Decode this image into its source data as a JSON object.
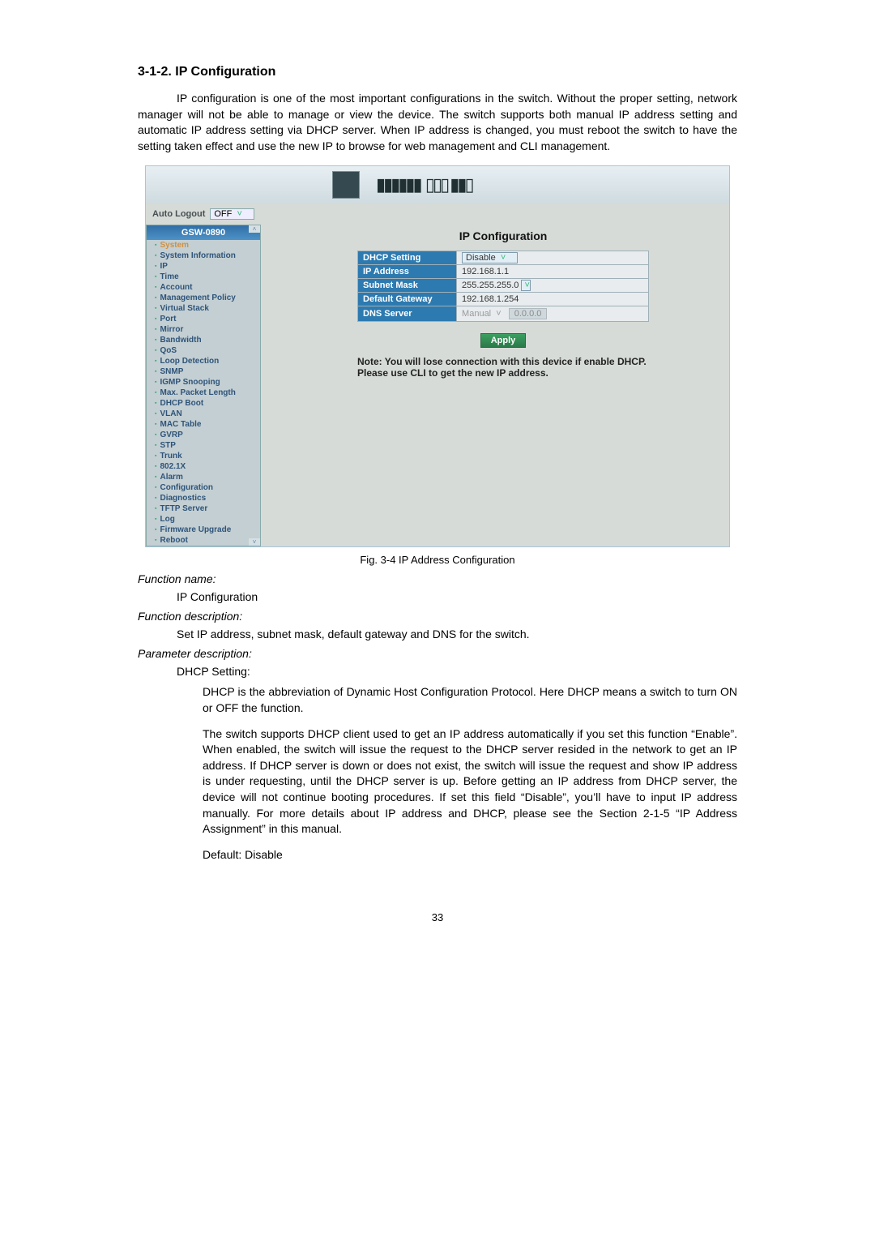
{
  "doc": {
    "heading": "3-1-2. IP Configuration",
    "intro": "IP configuration is one of the most important configurations in the switch. Without the proper setting, network manager will not be able to manage or view the device. The switch supports both manual IP address setting and automatic IP address setting via DHCP server. When IP address is changed, you must reboot the switch to have the setting taken effect and use the new IP to browse for web management and CLI management.",
    "fig_caption": "Fig. 3-4 IP Address Configuration",
    "fn_name_label": "Function name:",
    "fn_name_value": "IP Configuration",
    "fn_desc_label": "Function description:",
    "fn_desc_value": "Set IP address, subnet mask, default gateway and DNS for the switch.",
    "param_label": "Parameter description:",
    "param_name": "DHCP Setting:",
    "param_body1": "DHCP is the abbreviation of Dynamic Host Configuration Protocol. Here DHCP means a switch to turn ON or OFF the function.",
    "param_body2": "The switch supports DHCP client used to get an IP address automatically if you set this function “Enable”. When enabled, the switch will issue the request to the DHCP server resided in the network to get an IP address. If DHCP server is down or does not exist, the switch will issue the request and show IP address is under requesting, until the DHCP server is up. Before getting an IP address from DHCP server, the device will not continue booting procedures. If set this field “Disable”, you’ll have to input IP address manually. For more details about IP address and DHCP, please see the Section 2-1-5 “IP Address Assignment” in this manual.",
    "param_default": "Default:  Disable",
    "page_number": "33"
  },
  "ui": {
    "auto_logout_label": "Auto Logout",
    "auto_logout_value": "OFF",
    "device_model": "GSW-0890",
    "sidebar": {
      "items": [
        "System",
        "System Information",
        "IP",
        "Time",
        "Account",
        "Management Policy",
        "Virtual Stack",
        "Port",
        "Mirror",
        "Bandwidth",
        "QoS",
        "Loop Detection",
        "SNMP",
        "IGMP Snooping",
        "Max. Packet Length",
        "DHCP Boot",
        "VLAN",
        "MAC Table",
        "GVRP",
        "STP",
        "Trunk",
        "802.1X",
        "Alarm",
        "Configuration",
        "Diagnostics",
        "TFTP Server",
        "Log",
        "Firmware Upgrade",
        "Reboot"
      ]
    },
    "panel": {
      "title": "IP Configuration",
      "rows": {
        "dhcp_label": "DHCP Setting",
        "dhcp_value": "Disable",
        "ip_label": "IP Address",
        "ip_value": "192.168.1.1",
        "mask_label": "Subnet Mask",
        "mask_value": "255.255.255.0",
        "gw_label": "Default Gateway",
        "gw_value": "192.168.1.254",
        "dns_label": "DNS Server",
        "dns_mode": "Manual",
        "dns_value": "0.0.0.0"
      },
      "apply": "Apply",
      "note": "Note: You will lose connection with this device if enable DHCP. Please use CLI to get the new IP address."
    }
  }
}
